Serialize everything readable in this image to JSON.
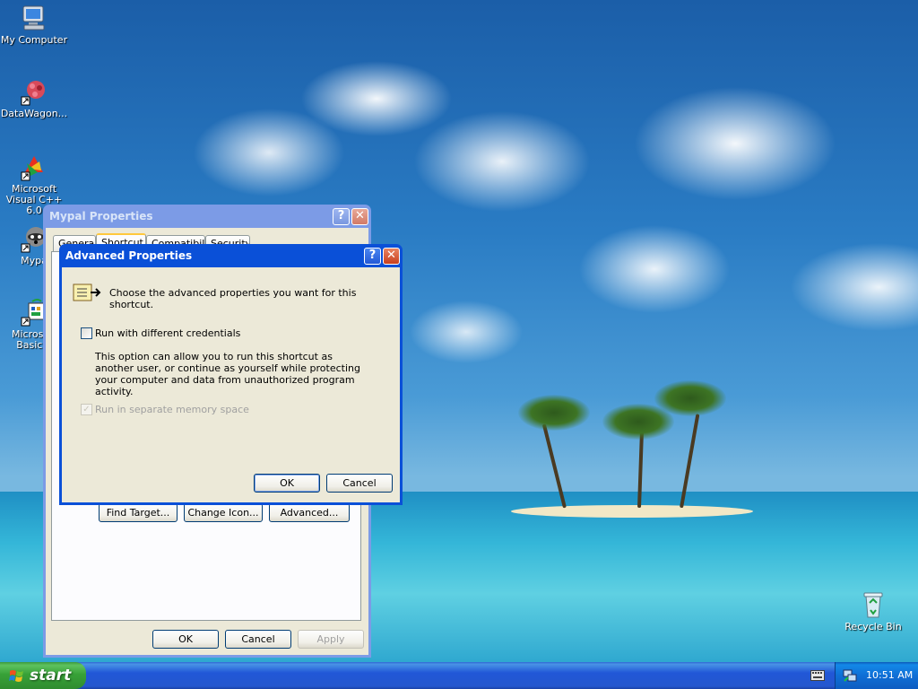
{
  "desktop": {
    "icons": [
      {
        "label": "My Computer"
      },
      {
        "label": "DataWagon..."
      },
      {
        "label": "Microsoft Visual C++ 6.0"
      },
      {
        "label": "Mypa"
      },
      {
        "label": "Microsoft Basic 6"
      },
      {
        "label": "Recycle Bin"
      }
    ]
  },
  "properties_window": {
    "title": "Mypal Properties",
    "tabs": [
      "General",
      "Shortcut",
      "Compatibility",
      "Security"
    ],
    "selected_tab": "Shortcut",
    "find_target_label": "Find Target...",
    "change_icon_label": "Change Icon...",
    "advanced_label": "Advanced...",
    "ok_label": "OK",
    "cancel_label": "Cancel",
    "apply_label": "Apply"
  },
  "advanced_dialog": {
    "title": "Advanced Properties",
    "heading": "Choose the advanced properties you want for this shortcut.",
    "run_credentials_label": "Run with different credentials",
    "run_credentials_checked": false,
    "description": "This option can allow you to run this shortcut as another user, or continue as yourself while protecting your computer and data from unauthorized program activity.",
    "separate_memory_label": "Run in separate memory space",
    "separate_memory_checked": true,
    "ok_label": "OK",
    "cancel_label": "Cancel"
  },
  "taskbar": {
    "start_label": "start",
    "clock": "10:51 AM"
  },
  "colors": {
    "titlebar_active": "#0a50d8",
    "titlebar_inactive": "#7c9be6",
    "dialog_face": "#ece9d8",
    "start_green": "#38a238",
    "taskbar_blue": "#2457ce"
  }
}
